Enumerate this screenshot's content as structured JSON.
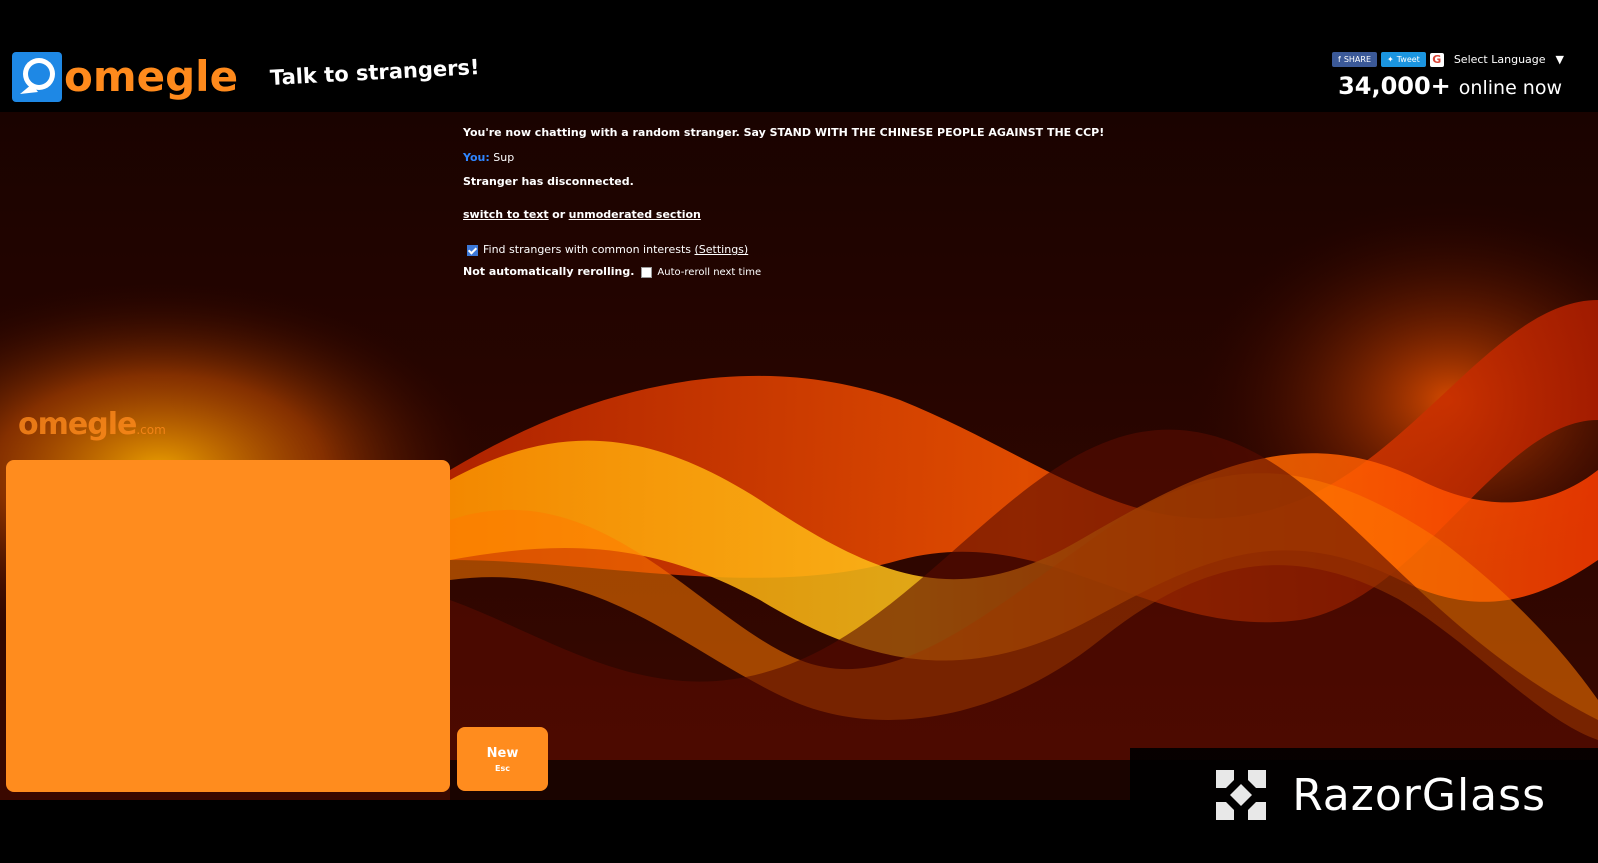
{
  "header": {
    "logo_text": "omegle",
    "tagline": "Talk to strangers!",
    "share": {
      "facebook": "SHARE",
      "twitter": "Tweet",
      "google_letter": "G",
      "language": "Select Language"
    },
    "online_count": "34,000+",
    "online_label": "online now"
  },
  "chat": {
    "intro": "You're now chatting with a random stranger. Say STAND WITH THE CHINESE PEOPLE AGAINST THE CCP!",
    "you_label": "You:",
    "you_message": "Sup",
    "disconnected": "Stranger has disconnected.",
    "switch_text": "switch to text",
    "switch_or": "or",
    "unmoderated": "unmoderated section",
    "interests_label": "Find strangers with common interests",
    "interests_checked": true,
    "settings_link": "(Settings)",
    "reroll_status": "Not automatically rerolling.",
    "autoreroll_label": "Auto-reroll next time",
    "autoreroll_checked": false
  },
  "video": {
    "watermark": "omegle",
    "watermark_suffix": ".com"
  },
  "controls": {
    "new_label": "New",
    "new_shortcut": "Esc"
  },
  "overlay": {
    "brand": "RazorGlass"
  },
  "colors": {
    "accent": "#ff8c1e",
    "you": "#2f86ff",
    "background": "#000000"
  }
}
